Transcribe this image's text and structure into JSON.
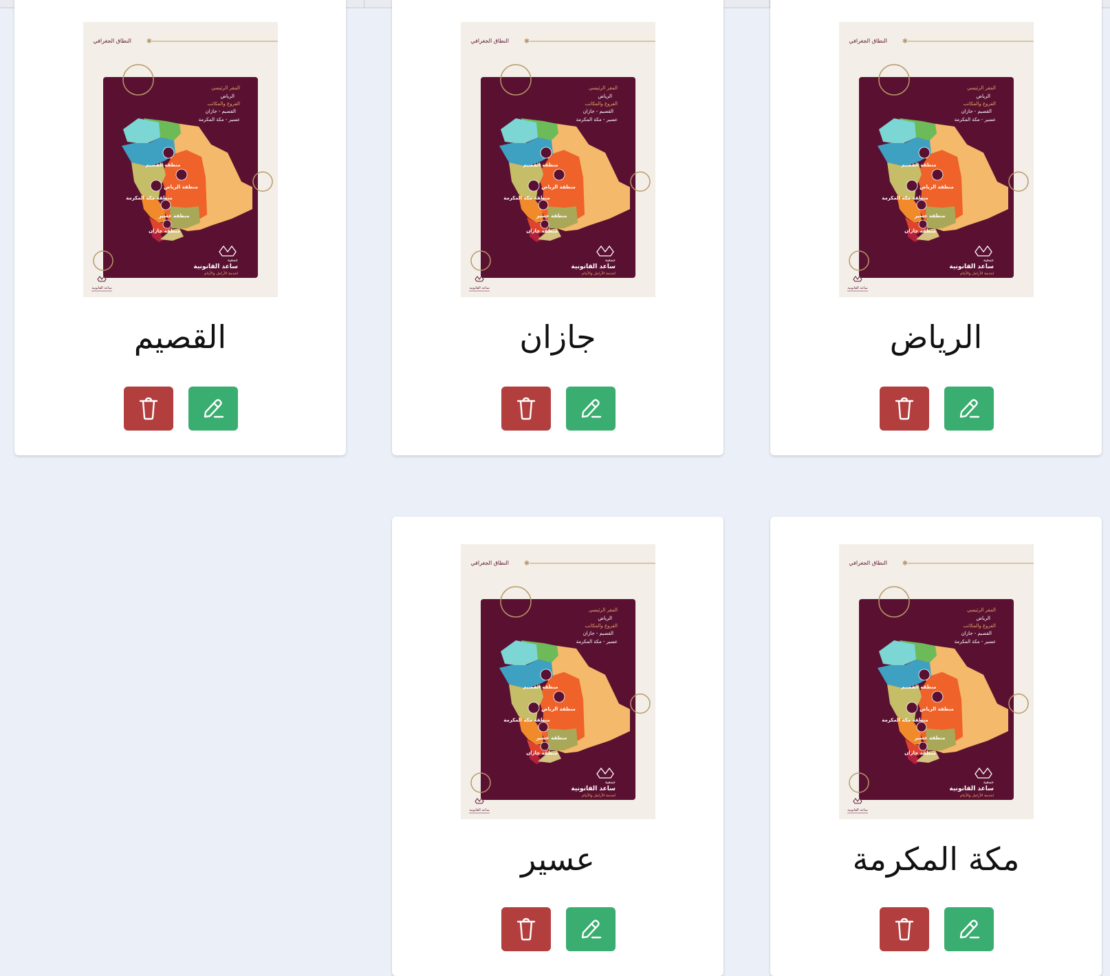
{
  "theme": {
    "background": "#ebeff7",
    "delete_color": "#b23e3e",
    "edit_color": "#3aad70",
    "poster_bg": "#f3efe8",
    "poster_panel": "#5a1131"
  },
  "poster": {
    "header": "النطاق الجغرافي",
    "hq_label": "المقر الرئيسي",
    "hq_value": "الرياض",
    "branches_label": "الفروع والمكاتب",
    "branches_line1": "القصيم - جازان",
    "branches_line2": "عسير - مكة المكرمة",
    "region_qassim": "منطقة القصيم",
    "region_riyadh": "منطقة الرياض",
    "region_makkah": "منطقة مكة المكرمة",
    "region_asir": "منطقة عسير",
    "region_jazan": "منطقة جازان",
    "org_prefix": "جمعية",
    "org_name": "ساعد القانونية",
    "org_tagline": "لخدمة الأرامل والأيتام",
    "small_logo": "ساعد القانونية"
  },
  "cards": [
    {
      "title": "الرياض",
      "delete_icon": "trash-icon",
      "edit_icon": "pencil-icon"
    },
    {
      "title": "جازان",
      "delete_icon": "trash-icon",
      "edit_icon": "pencil-icon"
    },
    {
      "title": "القصيم",
      "delete_icon": "trash-icon",
      "edit_icon": "pencil-icon"
    },
    {
      "title": "مكة المكرمة",
      "delete_icon": "trash-icon",
      "edit_icon": "pencil-icon"
    },
    {
      "title": "عسير",
      "delete_icon": "trash-icon",
      "edit_icon": "pencil-icon"
    }
  ]
}
